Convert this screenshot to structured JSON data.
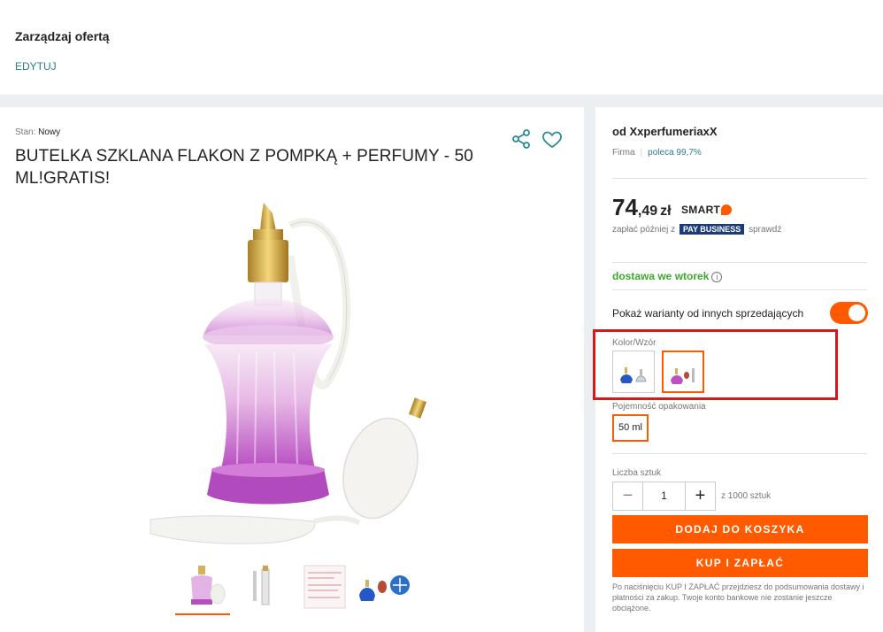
{
  "manage": {
    "title": "Zarządzaj ofertą",
    "edit_label": "EDYTUJ"
  },
  "product": {
    "condition_label": "Stan:",
    "condition_value": "Nowy",
    "title": "BUTELKA SZKLANA FLAKON Z POMPKĄ + PERFUMY - 50 ML!GRATIS!"
  },
  "gallery": {
    "thumbnails": [
      "bottle-pink-pump",
      "vial-spray",
      "leaflet",
      "blue-bottle",
      "blue-round-bottle"
    ]
  },
  "seller": {
    "prefix": "od",
    "name": "XxperfumeriaxX",
    "type": "Firma",
    "recommend": "poleca 99,7%"
  },
  "price": {
    "integer": "74",
    "decimal": ",49",
    "currency": "zł",
    "smart": "SMART",
    "pay_prefix": "zapłać później z",
    "pay_brand": "PAY BUSINESS",
    "pay_suffix": "sprawdź"
  },
  "delivery": {
    "text": "dostawa we wtorek"
  },
  "variants": {
    "label": "Pokaż warianty od innych sprzedających",
    "enabled": true
  },
  "color": {
    "label": "Kolor/Wzór",
    "selected_index": 1
  },
  "capacity": {
    "label": "Pojemność opakowania",
    "options": [
      "50 ml"
    ],
    "selected": "50 ml"
  },
  "quantity": {
    "label": "Liczba sztuk",
    "value": "1",
    "of_text": "z 1000 sztuk"
  },
  "buttons": {
    "add_to_cart": "DODAJ DO KOSZYKA",
    "buy_now": "KUP I ZAPŁAĆ"
  },
  "note": "Po naciśnięciu KUP I ZAPŁAĆ przejdziesz do podsumowania dostawy i płatności za zakup. Twoje konto bankowe nie zostanie jeszcze obciążone.",
  "colors": {
    "accent": "#ff5a00",
    "delivery": "#3fa72e",
    "link": "#2a7b8e",
    "highlight": "#d7191c"
  }
}
